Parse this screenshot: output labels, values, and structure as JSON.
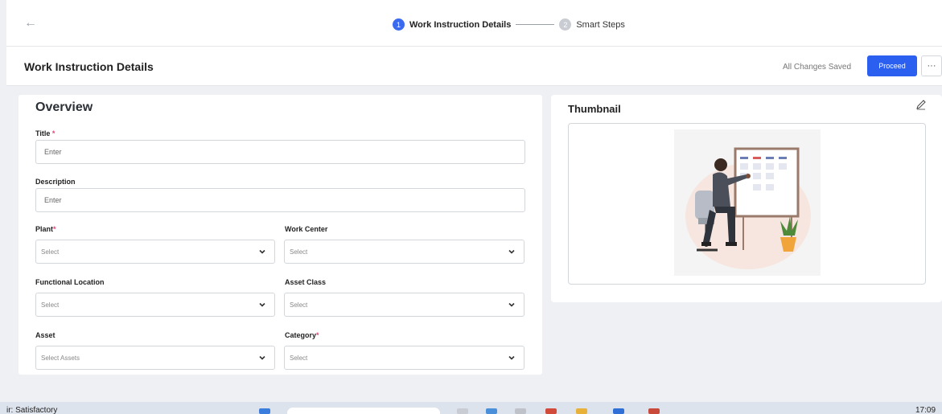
{
  "stepper": {
    "back_icon": "arrow-left-icon",
    "steps": [
      {
        "number": "1",
        "label": "Work Instruction Details",
        "state": "active"
      },
      {
        "number": "2",
        "label": "Smart Steps",
        "state": "inactive"
      }
    ]
  },
  "header": {
    "title": "Work Instruction Details",
    "status": "All Changes Saved",
    "proceed_label": "Proceed",
    "more_label": "···"
  },
  "overview": {
    "title": "Overview",
    "fields": {
      "title": {
        "label": "Title",
        "required_mark": "*",
        "placeholder": "Enter"
      },
      "description": {
        "label": "Description",
        "placeholder": "Enter"
      },
      "plant": {
        "label": "Plant",
        "required_mark": "*",
        "value": "Select"
      },
      "work_center": {
        "label": "Work Center",
        "value": "Select"
      },
      "functional_location": {
        "label": "Functional Location",
        "value": "Select"
      },
      "asset_class": {
        "label": "Asset Class",
        "value": "Select"
      },
      "asset": {
        "label": "Asset",
        "value": "Select Assets"
      },
      "category": {
        "label": "Category",
        "required_mark": "*",
        "value": "Select"
      }
    }
  },
  "thumbnail": {
    "title": "Thumbnail",
    "edit_icon": "pencil-icon"
  },
  "taskbar": {
    "left_text": "ir: Satisfactory",
    "time": "17:09"
  },
  "colors": {
    "primary": "#2a5ff0",
    "required": "#e0457b",
    "step_active": "#3a6af0",
    "step_inactive": "#c9ccd2"
  }
}
